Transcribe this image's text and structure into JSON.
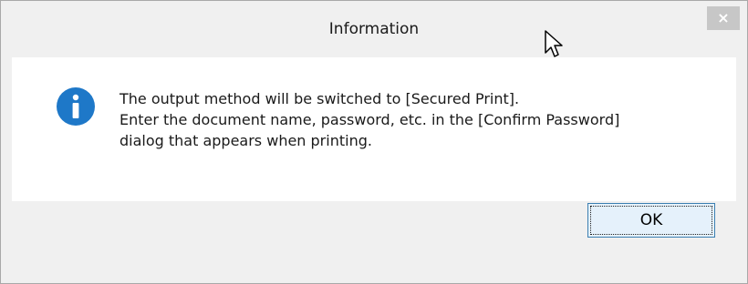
{
  "window": {
    "title": "Information",
    "close_glyph": "×"
  },
  "dialog": {
    "icon": "info-icon",
    "message_lines": [
      "The output method will be switched to [Secured Print].",
      "Enter the document name, password, etc. in the [Confirm Password]",
      "dialog that appears when printing."
    ]
  },
  "buttons": {
    "ok_label": "OK"
  },
  "colors": {
    "info_icon_blue": "#1e78c8",
    "window_bg": "#f0f0f0",
    "content_bg": "#ffffff",
    "close_button_bg": "#c7c7c7",
    "ok_button_border": "#3c7fb1",
    "ok_button_bg": "#e5f1fb"
  }
}
